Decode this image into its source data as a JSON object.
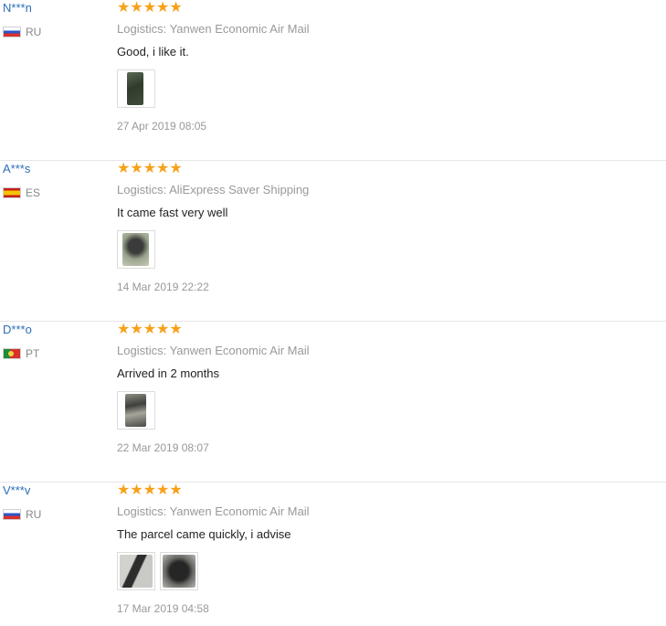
{
  "reviews": [
    {
      "user": "N***n",
      "country": "RU",
      "rating": 5,
      "stars": "★★★★★",
      "logistics": "Logistics: Yanwen Economic Air Mail",
      "comment": "Good, i like it.",
      "photos": [
        {
          "icon": "review-photo",
          "colors": [
            "#2f3b2c",
            "#5a6a55"
          ]
        }
      ],
      "date": "27 Apr 2019 08:05"
    },
    {
      "user": "A***s",
      "country": "ES",
      "rating": 5,
      "stars": "★★★★★",
      "logistics": "Logistics: AliExpress Saver Shipping",
      "comment": "It came fast very well",
      "photos": [
        {
          "icon": "review-photo",
          "colors": [
            "#9aa48c",
            "#3b3b3b"
          ]
        }
      ],
      "date": "14 Mar 2019 22:22"
    },
    {
      "user": "D***o",
      "country": "PT",
      "rating": 5,
      "stars": "★★★★★",
      "logistics": "Logistics: Yanwen Economic Air Mail",
      "comment": "Arrived in 2 months",
      "photos": [
        {
          "icon": "review-photo",
          "colors": [
            "#5a5a55",
            "#a5a59a"
          ]
        }
      ],
      "date": "22 Mar 2019 08:07"
    },
    {
      "user": "V***v",
      "country": "RU",
      "rating": 5,
      "stars": "★★★★★",
      "logistics": "Logistics: Yanwen Economic Air Mail",
      "comment": "The parcel came quickly, i advise",
      "photos": [
        {
          "icon": "review-photo",
          "colors": [
            "#c9c9c6",
            "#2d2d2d"
          ]
        },
        {
          "icon": "review-photo",
          "colors": [
            "#b8b8b4",
            "#262626"
          ]
        }
      ],
      "date": "17 Mar 2019 04:58"
    }
  ],
  "colors": {
    "username": "#2a6fb7",
    "stars": "#f7a11a",
    "muted": "#999999",
    "divider": "#e6e6e6"
  }
}
